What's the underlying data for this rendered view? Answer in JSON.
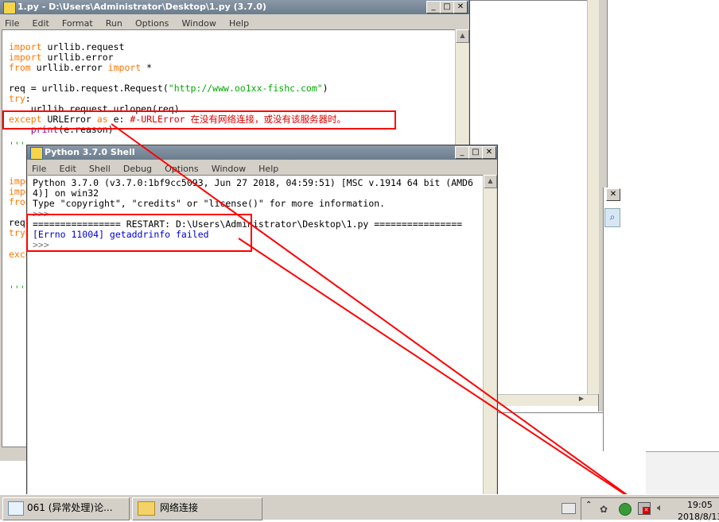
{
  "editor": {
    "title": "1.py - D:\\Users\\Administrator\\Desktop\\1.py (3.7.0)",
    "menu": [
      "File",
      "Edit",
      "Format",
      "Run",
      "Options",
      "Window",
      "Help"
    ],
    "line1_kw": "import",
    "line1_rest": " urllib.request",
    "line2_kw": "import",
    "line2_rest": " urllib.error",
    "line3_kw1": "from",
    "line3_mid": " urllib.error ",
    "line3_kw2": "import",
    "line3_rest": " *",
    "line4_pre": "req = urllib.request.Request(",
    "line4_str": "\"http://www.oo1xx-fishc.com\"",
    "line4_post": ")",
    "line5_kw": "try",
    "line5_rest": ":",
    "line6": "    urllib.request.urlopen(req)",
    "line7_kw1": "except",
    "line7_mid": " URLError ",
    "line7_kw2": "as",
    "line7_post": " e: ",
    "line7_cmt": "#-URLError 在没有网络连接，或没有该服务器时。",
    "line8_pre": "    ",
    "line8_builtin": "print",
    "line8_post": "(e.reason)",
    "line9": "'''",
    "frag1": "impo",
    "frag2": "impo",
    "frag3": "fron",
    "frag4": "req",
    "frag5": "try",
    "frag6": "exce",
    "frag7": "'''"
  },
  "shell": {
    "title": "Python 3.7.0 Shell",
    "menu": [
      "File",
      "Edit",
      "Shell",
      "Debug",
      "Options",
      "Window",
      "Help"
    ],
    "banner1": "Python 3.7.0 (v3.7.0:1bf9cc5093, Jun 27 2018, 04:59:51) [MSC v.1914 64 bit (AMD6",
    "banner2": "4)] on win32",
    "banner3": "Type \"copyright\", \"credits\" or \"license()\" for more information.",
    "prompt1": ">>>",
    "restart": "================ RESTART: D:\\Users\\Administrator\\Desktop\\1.py ================",
    "error": "[Errno 11004] getaddrinfo failed",
    "prompt2": ">>>"
  },
  "taskbar": {
    "item1": "061 (异常处理)论...",
    "item2": "网络连接",
    "time": "19:05",
    "date": "2018/8/13"
  },
  "colors": {
    "highlight": "#ff0000",
    "keyword": "#ff7700",
    "string": "#00aa00",
    "titlebar": "#6b7d8c"
  }
}
